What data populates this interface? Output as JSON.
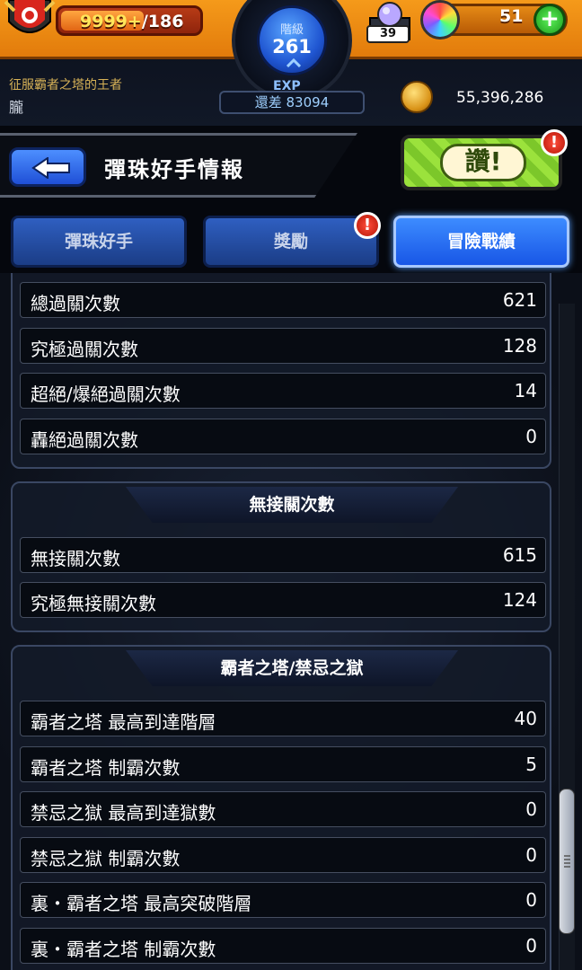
{
  "status_bar": {
    "stamina_current": "9999+",
    "stamina_max": "/186",
    "rank_label": "階級",
    "rank_value": "261",
    "exp_label": "EXP",
    "exp_remaining": "還差 83094",
    "orb_count": "39",
    "gem_count": "51",
    "player_title": "征服霸者之塔的王者",
    "player_name": "朧",
    "coins": "55,396,286"
  },
  "header": {
    "title": "彈珠好手情報",
    "like_label": "讚!",
    "alert_mark": "!"
  },
  "tabs": [
    {
      "label": "彈珠好手",
      "active": false
    },
    {
      "label": "獎勵",
      "active": false,
      "alert": true
    },
    {
      "label": "冒險戰績",
      "active": true
    }
  ],
  "sections": [
    {
      "title": "",
      "rows": [
        {
          "label": "總過關次數",
          "value": "621"
        },
        {
          "label": "究極過關次數",
          "value": "128"
        },
        {
          "label": "超絕/爆絕過關次數",
          "value": "14"
        },
        {
          "label": "轟絕過關次數",
          "value": "0"
        }
      ]
    },
    {
      "title": "無接關次數",
      "rows": [
        {
          "label": "無接關次數",
          "value": "615"
        },
        {
          "label": "究極無接關次數",
          "value": "124"
        }
      ]
    },
    {
      "title": "霸者之塔/禁忌之獄",
      "rows": [
        {
          "label": "霸者之塔 最高到達階層",
          "value": "40"
        },
        {
          "label": "霸者之塔 制霸次數",
          "value": "5"
        },
        {
          "label": "禁忌之獄 最高到達獄數",
          "value": "0"
        },
        {
          "label": "禁忌之獄 制霸次數",
          "value": "0"
        },
        {
          "label": "裏・霸者之塔 最高突破階層",
          "value": "0"
        },
        {
          "label": "裏・霸者之塔 制霸次數",
          "value": "0"
        }
      ]
    }
  ],
  "scroll_position": 0.72
}
